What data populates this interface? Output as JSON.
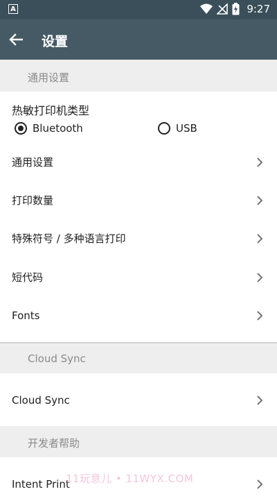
{
  "status_bar": {
    "app_icon_letter": "A",
    "time": "9:27",
    "icons": [
      "wifi-icon",
      "no-signal-icon",
      "battery-charging-icon"
    ]
  },
  "toolbar": {
    "title": "设置",
    "back_icon": "arrow-back-icon"
  },
  "sections": {
    "general": {
      "header": "通用设置",
      "printer_type_label": "热敏打印机类型",
      "printer_type_options": [
        {
          "label": "Bluetooth",
          "selected": true
        },
        {
          "label": "USB",
          "selected": false
        }
      ],
      "items": [
        {
          "label": "通用设置"
        },
        {
          "label": "打印数量"
        },
        {
          "label": "特殊符号 / 多种语言打印"
        },
        {
          "label": "短代码"
        },
        {
          "label": "Fonts"
        }
      ]
    },
    "cloud_sync": {
      "header": "Cloud Sync",
      "items": [
        {
          "label": "Cloud Sync"
        }
      ]
    },
    "developer": {
      "header": "开发者帮助",
      "items": [
        {
          "label": "Intent Print"
        }
      ]
    }
  },
  "watermark": "11玩意儿 • 11WYX.COM",
  "colors": {
    "status_bar": "#3a4f59",
    "toolbar": "#455a64",
    "section_bg": "#eeeeee",
    "section_text": "#8a8a8a"
  }
}
